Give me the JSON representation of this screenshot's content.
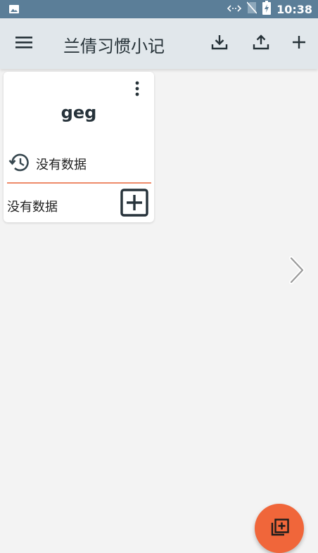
{
  "status_bar": {
    "time": "10:38",
    "icons": [
      "image-icon",
      "data-transfer-icon",
      "no-sim-icon",
      "battery-charging-icon"
    ]
  },
  "app_bar": {
    "title": "兰倩习惯小记",
    "actions": [
      "menu-icon",
      "download-icon",
      "upload-icon",
      "add-icon"
    ]
  },
  "habit_card": {
    "name": "geg",
    "history_text": "没有数据",
    "footer_text": "没有数据",
    "accent_color": "#ee8a6a"
  },
  "fab": {
    "icon": "add-box-stack-icon",
    "color": "#f0663a"
  },
  "colors": {
    "status_bar": "#5b7e98",
    "app_bar": "#e1e7eb",
    "background": "#f3f3f3"
  }
}
